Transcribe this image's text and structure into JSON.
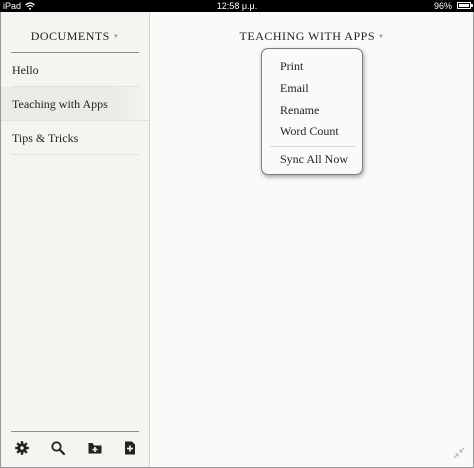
{
  "status_bar": {
    "device": "iPad",
    "time": "12:58 μ.μ.",
    "battery": "96%"
  },
  "sidebar": {
    "title": "DOCUMENTS",
    "items": [
      {
        "label": "Hello"
      },
      {
        "label": "Teaching with Apps"
      },
      {
        "label": "Tips & Tricks"
      }
    ],
    "toolbar": [
      "gear-icon",
      "search-icon",
      "folder-add-icon",
      "document-add-icon"
    ]
  },
  "main": {
    "title": "TEACHING WITH APPS",
    "menu": {
      "items": [
        {
          "label": "Print"
        },
        {
          "label": "Email"
        },
        {
          "label": "Rename"
        },
        {
          "label": "Word Count"
        }
      ],
      "sync_label": "Sync All Now"
    }
  }
}
